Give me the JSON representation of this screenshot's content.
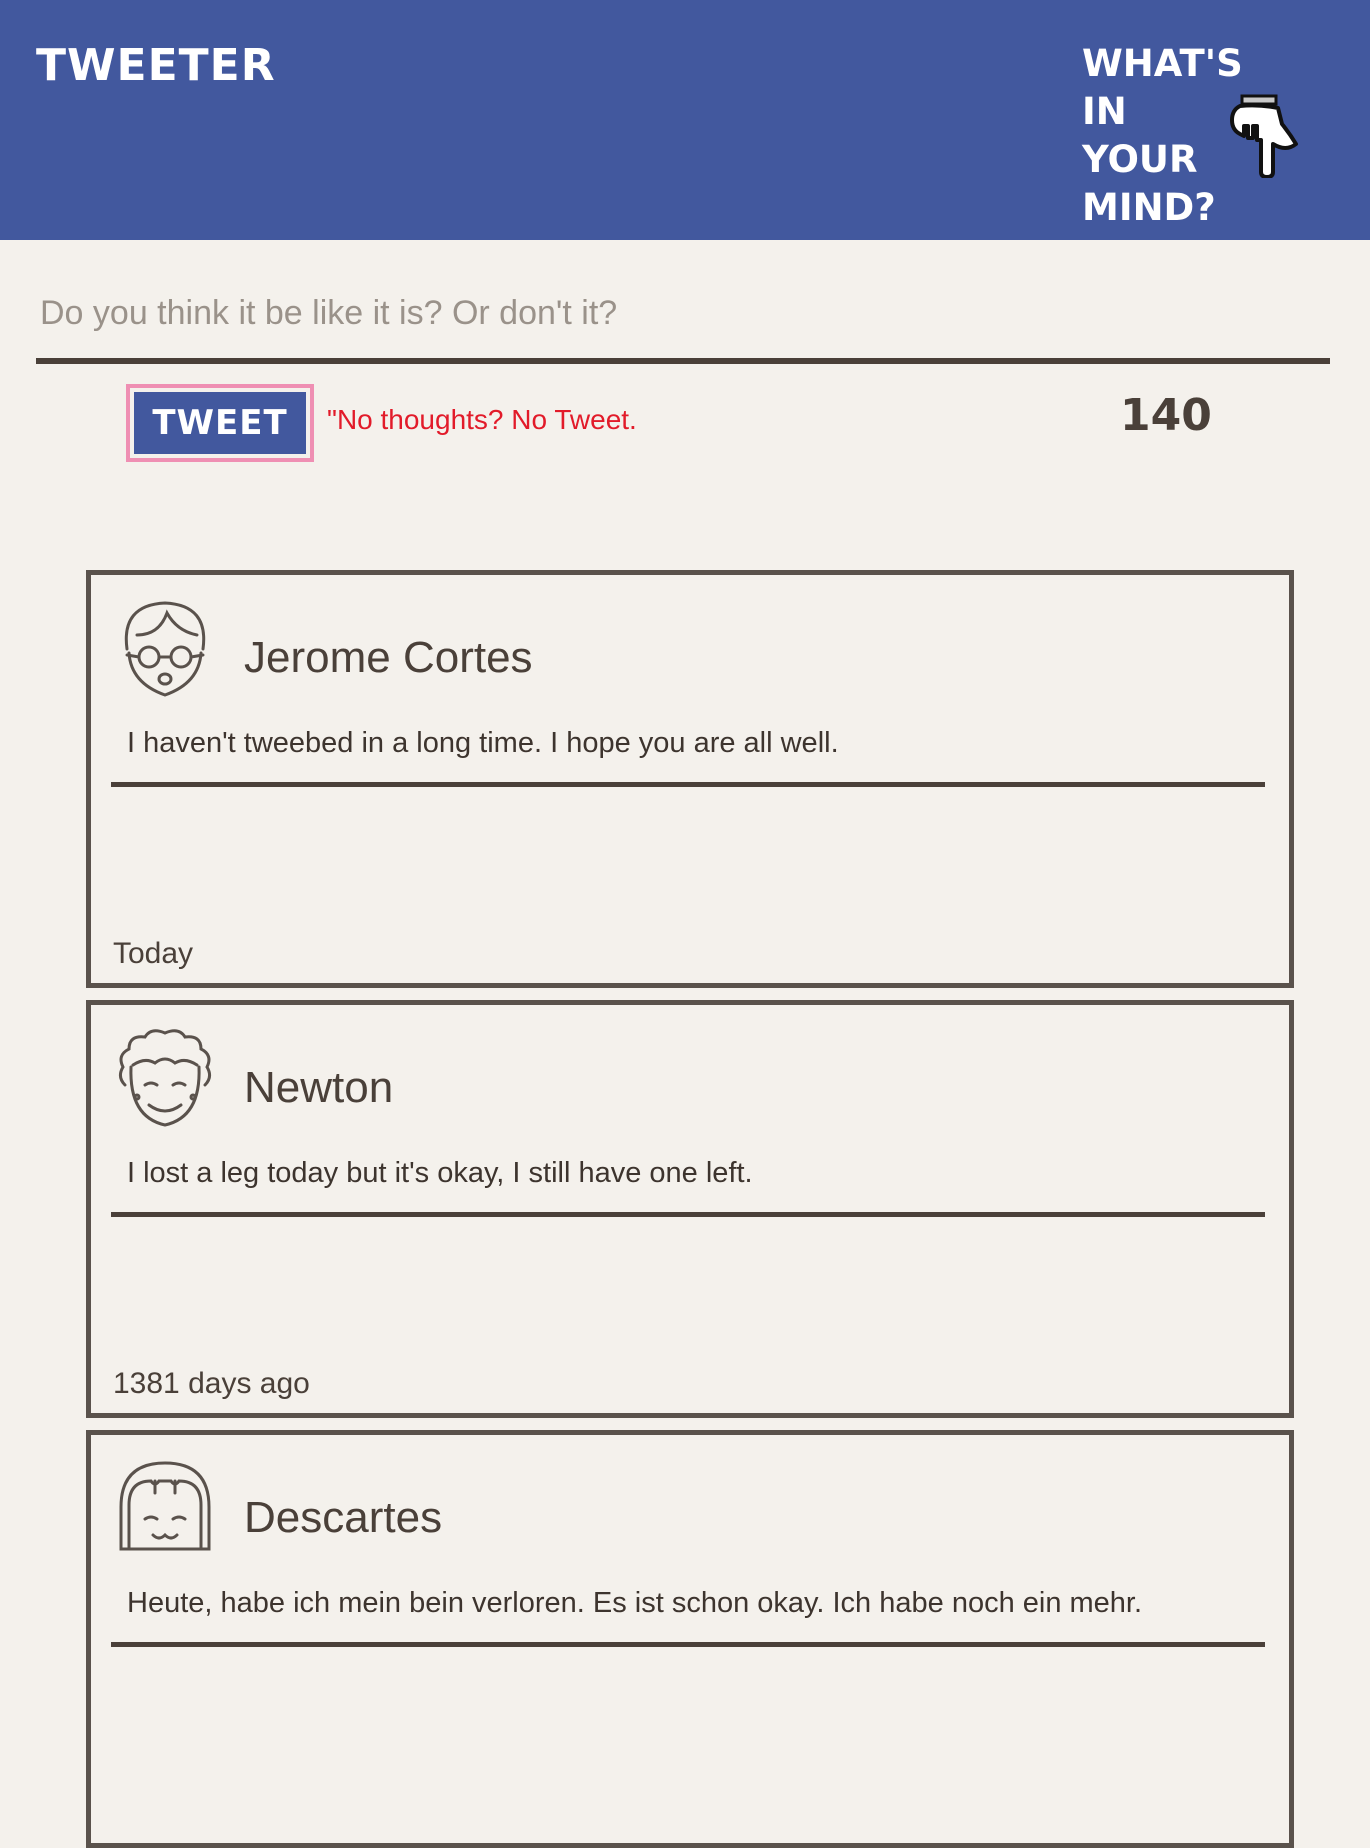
{
  "header": {
    "brand": "TWEETER",
    "prompt_lines": [
      "WHAT'S IN",
      "YOUR",
      "MIND?"
    ],
    "prompt_icon": "pointing-hand-icon"
  },
  "composer": {
    "placeholder": "Do you think it be like it is? Or don't it?",
    "value": "",
    "button_label": "TWEET",
    "error": "\"No thoughts? No Tweet.",
    "char_count": "140"
  },
  "tweets": [
    {
      "author": "Jerome Cortes",
      "avatar_icon": "avatar-glasses-icon",
      "text": "I haven't tweebed in a long time. I hope you are all well.",
      "time": "Today"
    },
    {
      "author": "Newton",
      "avatar_icon": "avatar-curly-hair-icon",
      "text": "I lost a leg today but it's okay, I still have one left.",
      "time": "1381 days ago"
    },
    {
      "author": "Descartes",
      "avatar_icon": "avatar-bangs-icon",
      "text": "Heute, habe ich mein bein verloren. Es ist schon okay. Ich habe noch ein mehr.",
      "time": ""
    }
  ],
  "colors": {
    "header_bg": "#42589e",
    "page_bg": "#f4f1ec",
    "text": "#4a4039",
    "error": "#e21b2a",
    "button_outline": "#ef8fb3"
  }
}
